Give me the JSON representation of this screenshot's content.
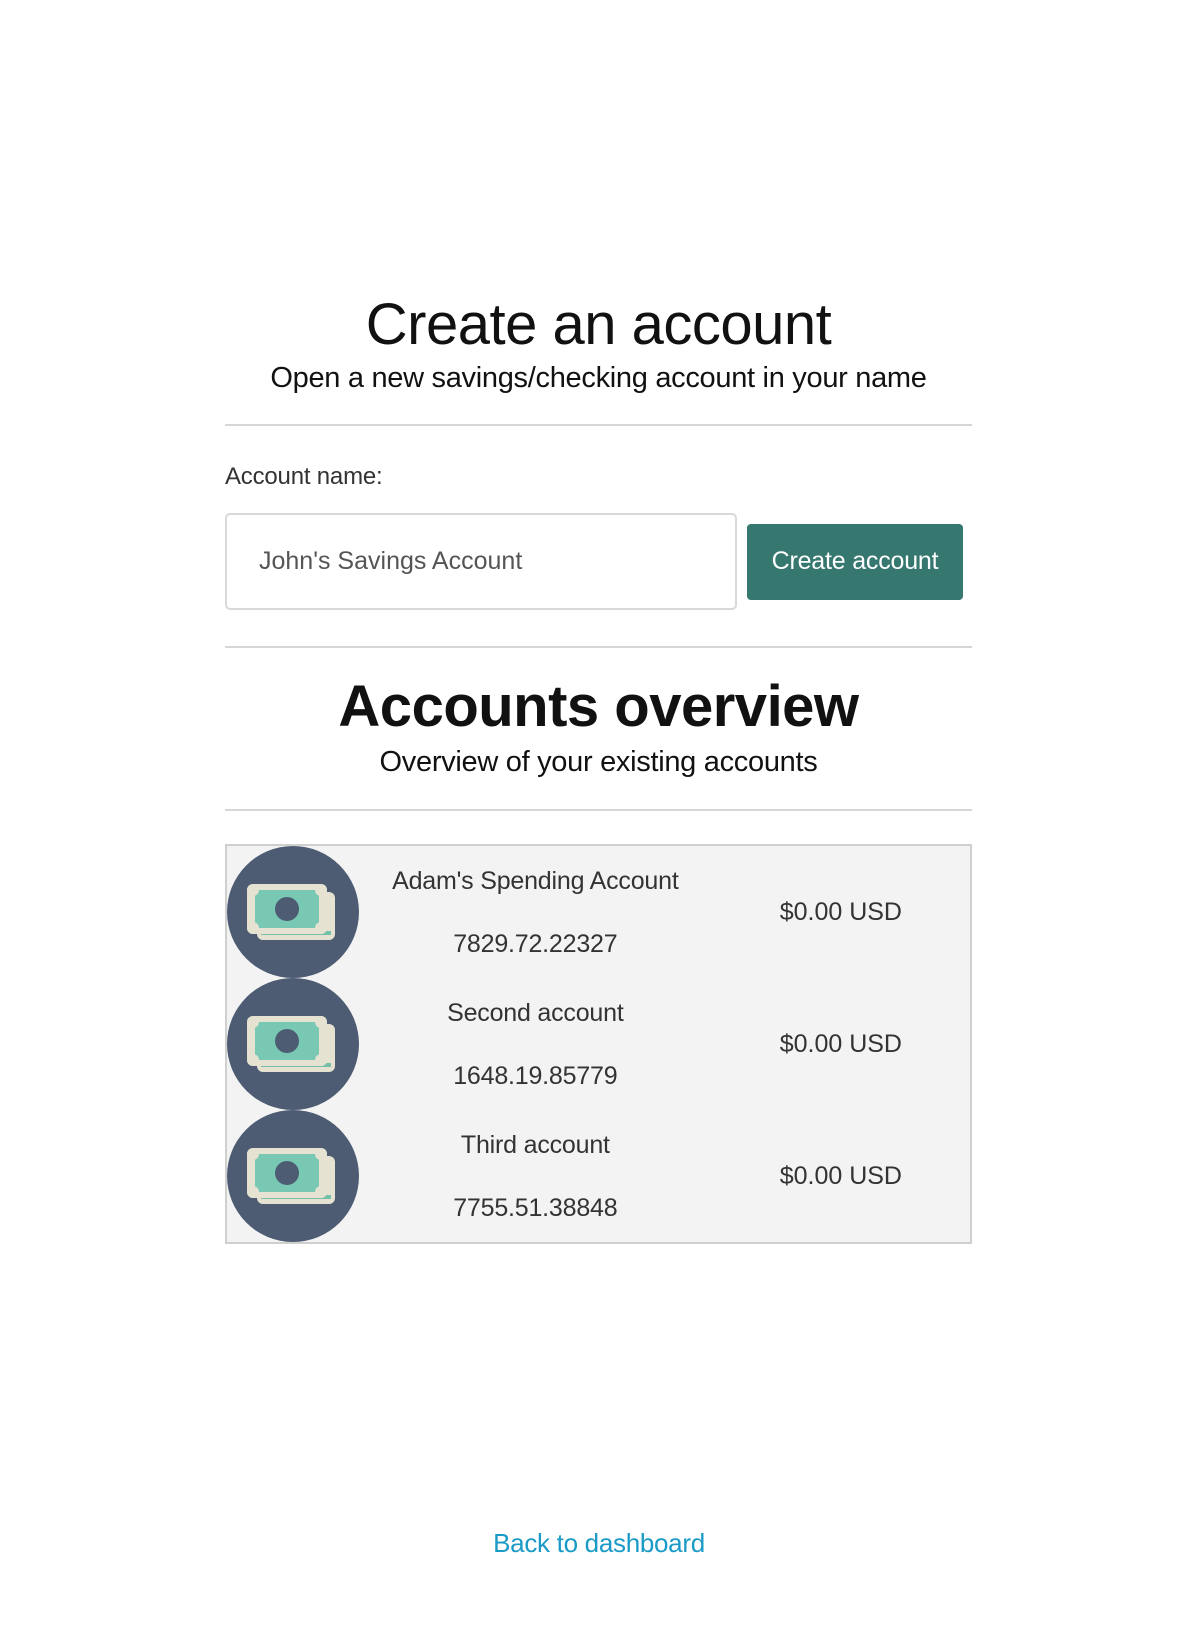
{
  "create_section": {
    "title": "Create an account",
    "subtitle": "Open a new savings/checking account in your name",
    "field_label": "Account name:",
    "input_value": "",
    "input_placeholder": "John's Savings Account",
    "button_label": "Create account"
  },
  "overview_section": {
    "title": "Accounts overview",
    "subtitle": "Overview of your existing accounts"
  },
  "accounts": [
    {
      "icon": "money-icon",
      "name": "Adam's Spending Account",
      "number": "7829.72.22327",
      "balance": "$0.00 USD"
    },
    {
      "icon": "money-icon",
      "name": "Second account",
      "number": "1648.19.85779",
      "balance": "$0.00 USD"
    },
    {
      "icon": "money-icon",
      "name": "Third account",
      "number": "7755.51.38848",
      "balance": "$0.00 USD"
    }
  ],
  "footer": {
    "back_link": "Back to dashboard"
  },
  "colors": {
    "primary_button": "#367870",
    "link": "#1a9ac6",
    "avatar_bg": "#4d5c72",
    "list_bg": "#f3f3f3"
  }
}
